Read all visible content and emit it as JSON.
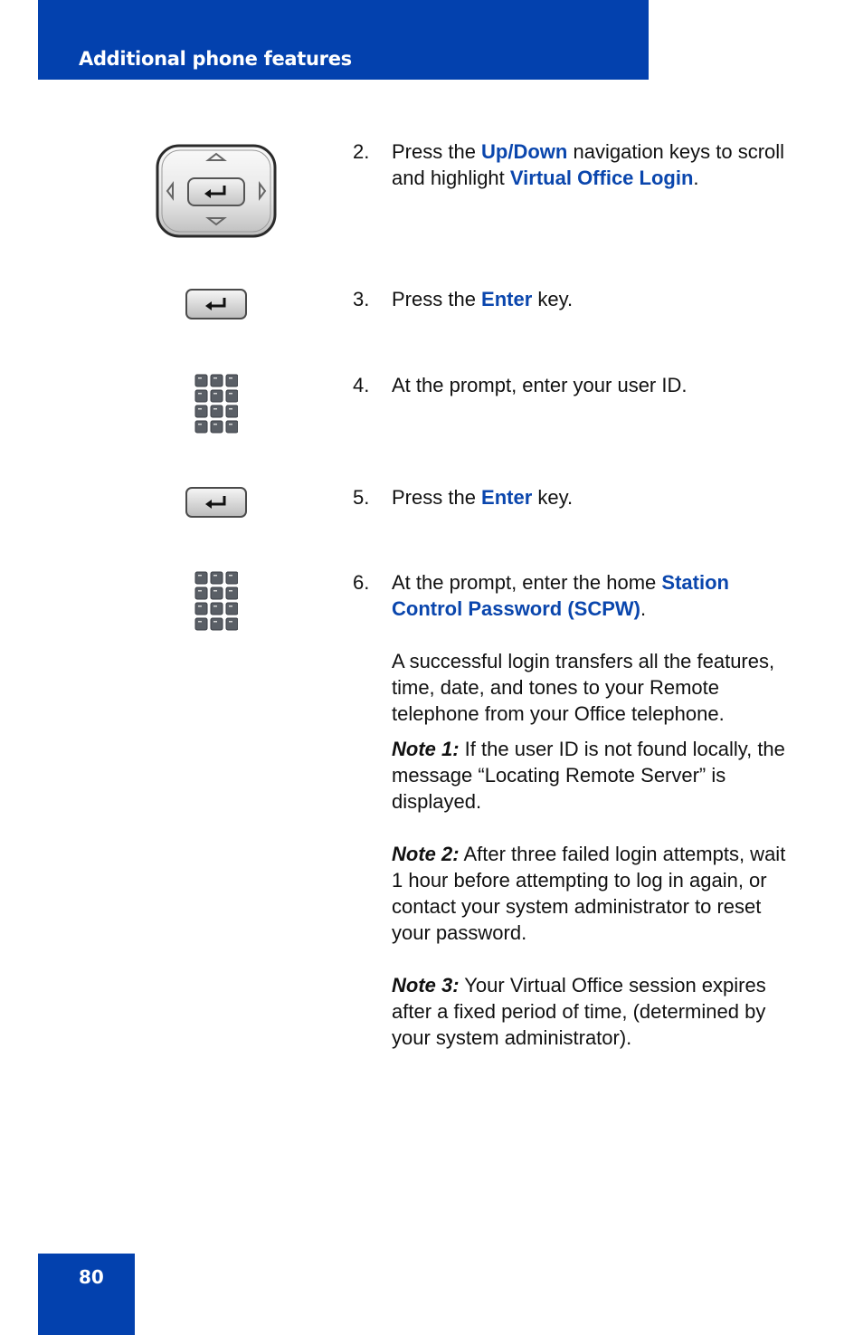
{
  "header": {
    "title": "Additional phone features",
    "color": "#0341ae"
  },
  "footer": {
    "page_number": "80"
  },
  "accent_color": "#0a46ad",
  "steps": [
    {
      "number": "2.",
      "icon": "navigation-cluster-icon",
      "parts": [
        "Press the ",
        "Up/Down",
        " navigation keys to scroll and highlight ",
        "Virtual Office Login",
        "."
      ]
    },
    {
      "number": "3.",
      "icon": "enter-key-icon",
      "parts": [
        "Press the ",
        "Enter",
        " key."
      ]
    },
    {
      "number": "4.",
      "icon": "dialpad-icon",
      "text": "At the prompt, enter your user ID."
    },
    {
      "number": "5.",
      "icon": "enter-key-icon",
      "parts": [
        "Press the ",
        "Enter",
        " key."
      ]
    },
    {
      "number": "6.",
      "icon": "dialpad-icon",
      "parts": [
        "At the prompt, enter the home ",
        "Station Control Password (SCPW)",
        "."
      ],
      "paragraph": "A successful login transfers all the features, time, date, and tones to your Remote telephone from your Office telephone.",
      "notes": [
        {
          "label": "Note 1:",
          "text": " If the user ID is not found locally, the message “Locating Remote Server” is displayed."
        },
        {
          "label": "Note 2:",
          "text": " After three failed login attempts, wait 1 hour before attempting to log in again, or contact your system administrator to reset your password."
        },
        {
          "label": "Note 3:",
          "text": " Your Virtual Office session expires after a fixed period of time, (determined by your system administrator)."
        }
      ]
    }
  ]
}
